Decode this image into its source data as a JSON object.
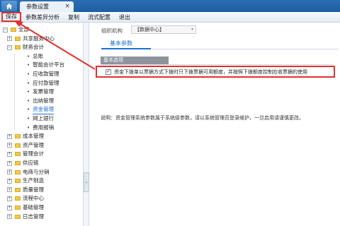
{
  "tabbar": {
    "home_icon": "home-icon",
    "tab_title": "参数设置",
    "close_glyph": "×"
  },
  "toolbar": {
    "items": [
      "保存",
      "参数差异分析",
      "复制",
      "流式配置",
      "退出"
    ]
  },
  "sidebar": {
    "items": [
      {
        "label": "全部",
        "toggle": "−",
        "kind": "root"
      },
      {
        "label": "共享服务中心",
        "toggle": "+",
        "kind": "group"
      },
      {
        "label": "财务会计",
        "toggle": "−",
        "kind": "group"
      },
      {
        "label": "总账",
        "kind": "leaf"
      },
      {
        "label": "智能会计平台",
        "kind": "leaf"
      },
      {
        "label": "应收款管理",
        "kind": "leaf"
      },
      {
        "label": "应付款管理",
        "kind": "leaf"
      },
      {
        "label": "发票管理",
        "kind": "leaf"
      },
      {
        "label": "出纳管理",
        "kind": "leaf"
      },
      {
        "label": "资金管理",
        "kind": "leaf",
        "selected": true
      },
      {
        "label": "网上银行",
        "kind": "leaf"
      },
      {
        "label": "费用报销",
        "kind": "leaf"
      },
      {
        "label": "成本管理",
        "toggle": "+",
        "kind": "group"
      },
      {
        "label": "资产管理",
        "toggle": "+",
        "kind": "group"
      },
      {
        "label": "管理会计",
        "toggle": "+",
        "kind": "group"
      },
      {
        "label": "供应链",
        "toggle": "+",
        "kind": "group"
      },
      {
        "label": "电商与分销",
        "toggle": "+",
        "kind": "group"
      },
      {
        "label": "生产制造",
        "toggle": "+",
        "kind": "group"
      },
      {
        "label": "质量管理",
        "toggle": "+",
        "kind": "group"
      },
      {
        "label": "流程中心",
        "toggle": "+",
        "kind": "group"
      },
      {
        "label": "基础管理",
        "toggle": "+",
        "kind": "group"
      },
      {
        "label": "日志管理",
        "toggle": "+",
        "kind": "group"
      }
    ]
  },
  "splitter": {
    "handle_glyph": "‹"
  },
  "main": {
    "org_label": "组织机构",
    "org_value": "【数据中心】",
    "org_arrow": "▾",
    "section_tab": "基本参数",
    "group_header": "基本选项",
    "option_checked_glyph": "✓",
    "option_text": "资金下拨单以票据方式下拨时只下拨票据可用额度，并按照下拨额度控制应收票据的使用",
    "note": "说明：资金管理系统参数属于系统级参数，请以系统管理员登录维护，一旦启用请谨慎更改。"
  },
  "colors": {
    "highlight": "#e0312f",
    "accent": "#1a6fd1",
    "tabbar": "#1e5ea3"
  }
}
